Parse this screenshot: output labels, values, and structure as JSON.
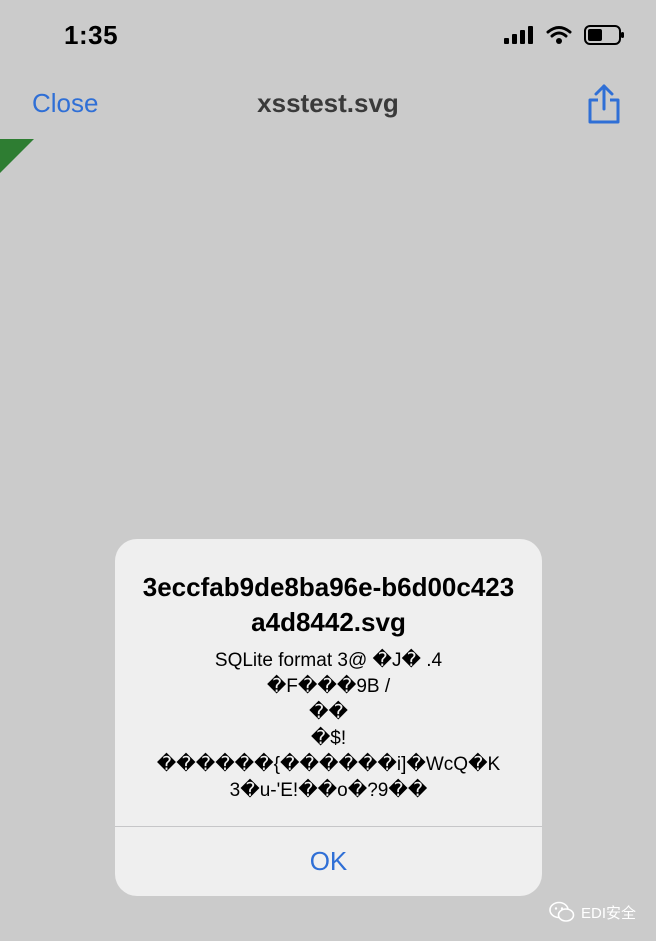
{
  "status_bar": {
    "time": "1:35"
  },
  "nav": {
    "close_label": "Close",
    "title": "xsstest.svg",
    "share_icon": "share-icon"
  },
  "alert": {
    "title": "3eccfab9de8ba96e-b6d00c423a4d8442.svg",
    "message": "SQLite format 3@    �J� .4\n�F���9B /\n��\n�$!\n������{������i]�WcQ�K\n3�u-'E!��o�?9��",
    "ok_label": "OK"
  },
  "watermark": {
    "text": "EDI安全"
  },
  "colors": {
    "background": "#cbcbcb",
    "accent": "#2f6fd6",
    "alert_bg": "#efefef",
    "corner_green": "#2e7d32"
  }
}
